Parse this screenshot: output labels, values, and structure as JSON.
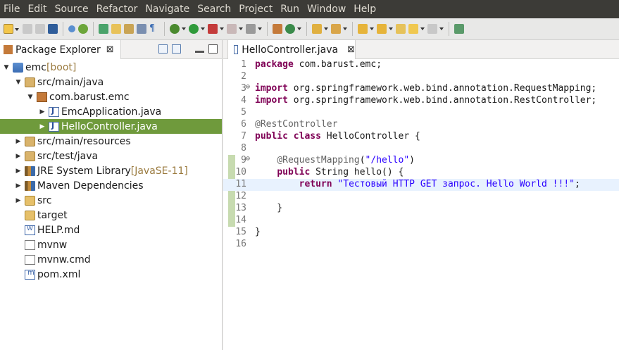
{
  "menu": [
    "File",
    "Edit",
    "Source",
    "Refactor",
    "Navigate",
    "Search",
    "Project",
    "Run",
    "Window",
    "Help"
  ],
  "package_explorer": {
    "title": "Package Explorer",
    "close_glyph": "⊠",
    "tree": [
      {
        "label": "emc",
        "suffix": " [boot]",
        "icon": "project-icon",
        "arrow": "▼",
        "indent": 0
      },
      {
        "label": "src/main/java",
        "suffix": "",
        "icon": "source-folder-icon",
        "arrow": "▼",
        "indent": 1
      },
      {
        "label": "com.barust.emc",
        "suffix": "",
        "icon": "package-icon",
        "arrow": "▼",
        "indent": 2
      },
      {
        "label": "EmcApplication.java",
        "suffix": "",
        "icon": "java-file-icon",
        "arrow": "▶",
        "indent": 3
      },
      {
        "label": "HelloController.java",
        "suffix": "",
        "icon": "java-file-icon",
        "arrow": "▶",
        "indent": 3,
        "selected": true
      },
      {
        "label": "src/main/resources",
        "suffix": "",
        "icon": "source-folder-icon",
        "arrow": "▶",
        "indent": 1
      },
      {
        "label": "src/test/java",
        "suffix": "",
        "icon": "source-folder-icon",
        "arrow": "▶",
        "indent": 1
      },
      {
        "label": "JRE System Library",
        "suffix": " [JavaSE-11]",
        "icon": "library-icon",
        "arrow": "▶",
        "indent": 1
      },
      {
        "label": "Maven Dependencies",
        "suffix": "",
        "icon": "library-icon",
        "arrow": "▶",
        "indent": 1
      },
      {
        "label": "src",
        "suffix": "",
        "icon": "folder-icon",
        "arrow": "▶",
        "indent": 1
      },
      {
        "label": "target",
        "suffix": "",
        "icon": "folder-icon",
        "arrow": "",
        "indent": 1
      },
      {
        "label": "HELP.md",
        "suffix": "",
        "icon": "markdown-file-icon",
        "arrow": "",
        "indent": 1
      },
      {
        "label": "mvnw",
        "suffix": "",
        "icon": "file-icon",
        "arrow": "",
        "indent": 1
      },
      {
        "label": "mvnw.cmd",
        "suffix": "",
        "icon": "file-icon",
        "arrow": "",
        "indent": 1
      },
      {
        "label": "pom.xml",
        "suffix": "",
        "icon": "xml-file-icon",
        "arrow": "",
        "indent": 1
      }
    ]
  },
  "editor": {
    "tab_title": "HelloController.java",
    "close_glyph": "⊠",
    "lines": [
      {
        "n": "1",
        "fold": "",
        "tokens": [
          [
            "kw",
            "package"
          ],
          [
            "",
            "com.barust.emc;"
          ]
        ]
      },
      {
        "n": "2",
        "fold": "",
        "tokens": []
      },
      {
        "n": "3",
        "fold": "⊖",
        "tokens": [
          [
            "kw",
            "import"
          ],
          [
            "",
            "org.springframework.web.bind.annotation.RequestMapping;"
          ]
        ]
      },
      {
        "n": "4",
        "fold": "",
        "tokens": [
          [
            "kw",
            "import"
          ],
          [
            "",
            "org.springframework.web.bind.annotation.RestController;"
          ]
        ]
      },
      {
        "n": "5",
        "fold": "",
        "tokens": []
      },
      {
        "n": "6",
        "fold": "",
        "tokens": [
          [
            "ann",
            "@RestController"
          ]
        ]
      },
      {
        "n": "7",
        "fold": "",
        "tokens": [
          [
            "kw",
            "public"
          ],
          [
            "",
            " "
          ],
          [
            "kw",
            "class"
          ],
          [
            "",
            " HelloController {"
          ]
        ]
      },
      {
        "n": "8",
        "fold": "",
        "tokens": []
      },
      {
        "n": "9",
        "fold": "⊖",
        "tokens": [
          [
            "",
            "    "
          ],
          [
            "ann",
            "@RequestMapping"
          ],
          [
            "",
            "("
          ],
          [
            "str",
            "\"/hello\""
          ],
          [
            "",
            ")"
          ]
        ]
      },
      {
        "n": "10",
        "fold": "",
        "tokens": [
          [
            "",
            "    "
          ],
          [
            "kw",
            "public"
          ],
          [
            "",
            " String hello() {"
          ]
        ]
      },
      {
        "n": "11",
        "fold": "",
        "highlight": true,
        "tokens": [
          [
            "",
            "        "
          ],
          [
            "kw",
            "return"
          ],
          [
            "",
            " "
          ],
          [
            "str",
            "\"Тестовый HTTP GET запрос. Hello World !!!\""
          ],
          [
            "",
            ";"
          ]
        ]
      },
      {
        "n": "12",
        "fold": "",
        "tokens": []
      },
      {
        "n": "13",
        "fold": "",
        "tokens": [
          [
            "",
            "    }"
          ]
        ]
      },
      {
        "n": "14",
        "fold": "",
        "tokens": []
      },
      {
        "n": "15",
        "fold": "",
        "tokens": [
          [
            "",
            "}"
          ]
        ]
      },
      {
        "n": "16",
        "fold": "",
        "tokens": []
      }
    ]
  },
  "colors": {
    "selection": "#6f9a3c",
    "keyword": "#7f0055",
    "string": "#2a00ff",
    "annotation": "#646464",
    "current_line": "#e8f2fe",
    "menubar": "#3c3b37"
  }
}
